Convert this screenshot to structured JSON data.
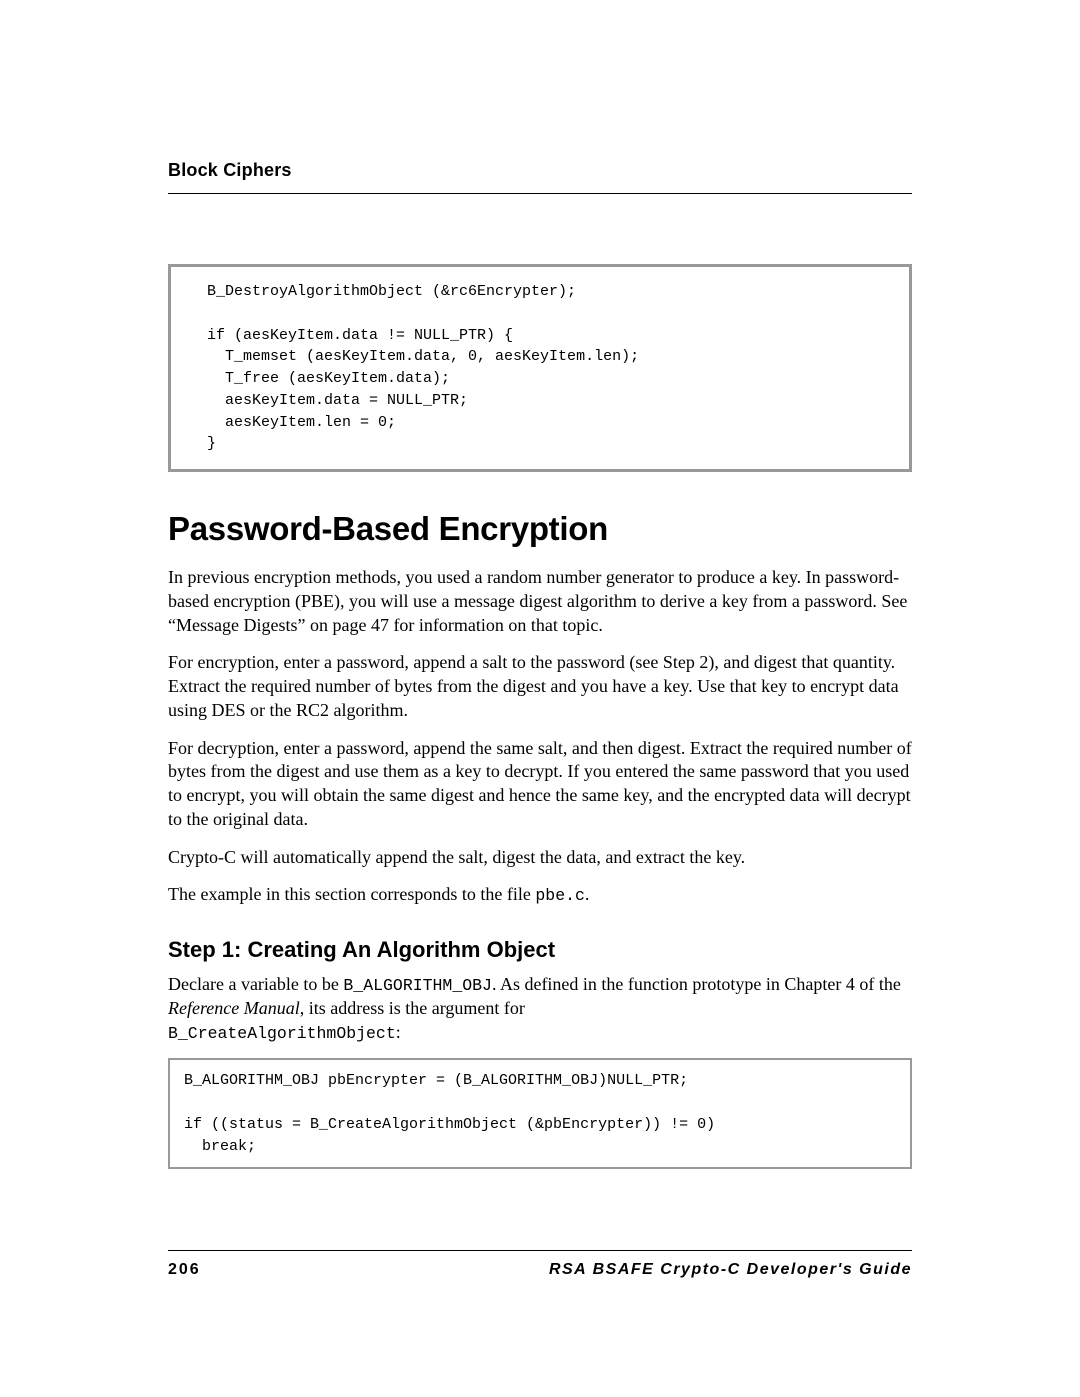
{
  "header": {
    "section": "Block Ciphers"
  },
  "code_top": "  B_DestroyAlgorithmObject (&rc6Encrypter);\n\n  if (aesKeyItem.data != NULL_PTR) {\n    T_memset (aesKeyItem.data, 0, aesKeyItem.len);\n    T_free (aesKeyItem.data);\n    aesKeyItem.data = NULL_PTR;\n    aesKeyItem.len = 0;\n  }",
  "heading": "Password-Based Encryption",
  "p1": "In previous encryption methods, you used a random number generator to produce a key. In password-based encryption (PBE), you will use a message digest algorithm to derive a key from a password. See “Message Digests” on page 47 for information on that topic.",
  "p2": "For encryption, enter a password, append a salt to the password (see Step 2), and digest that quantity. Extract the required number of bytes from the digest and you have a key. Use that key to encrypt data using DES or the RC2 algorithm.",
  "p3": "For decryption, enter a password, append the same salt, and then digest. Extract the required number of bytes from the digest and use them as a key to decrypt. If you entered the same password that you used to encrypt, you will obtain the same digest and hence the same key, and the encrypted data will decrypt to the original data.",
  "p4": "Crypto-C will automatically append the salt, digest the data, and extract the key.",
  "p5_a": "The example in this section corresponds to the file ",
  "p5_code": "pbe.c",
  "p5_b": ".",
  "step_heading": "Step 1:  Creating An Algorithm Object",
  "step_p_a": "Declare a variable to be ",
  "step_p_code1": "B_ALGORITHM_OBJ",
  "step_p_b": ". As defined in the function prototype in Chapter 4 of the ",
  "step_p_italic": "Reference Manual",
  "step_p_c": ", its address is the argument for ",
  "step_p_code2": "B_CreateAlgorithmObject",
  "step_p_d": ":",
  "code_bottom": "B_ALGORITHM_OBJ pbEncrypter = (B_ALGORITHM_OBJ)NULL_PTR;\n\nif ((status = B_CreateAlgorithmObject (&pbEncrypter)) != 0)\n  break;",
  "footer": {
    "page_number": "206",
    "doc_title": "RSA BSAFE Crypto-C Developer's Guide"
  }
}
